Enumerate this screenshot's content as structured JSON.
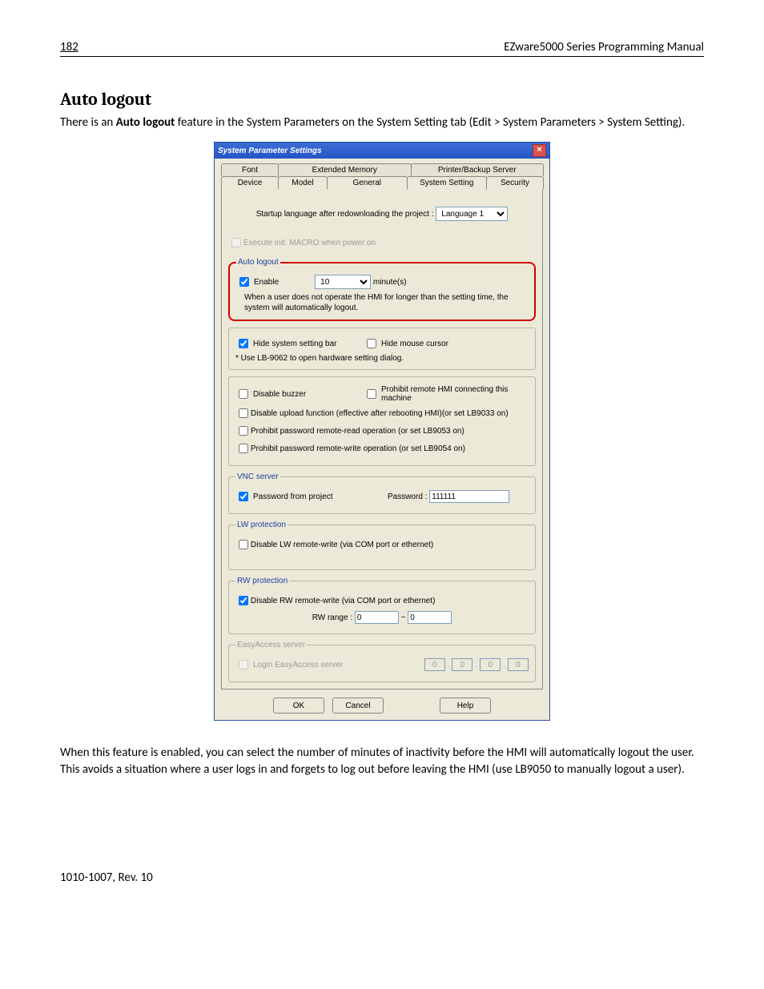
{
  "header": {
    "page_number": "182",
    "manual_title": "EZware5000 Series Programming Manual"
  },
  "section": {
    "heading": "Auto logout",
    "intro_prefix": "There is an ",
    "intro_bold": "Auto logout",
    "intro_suffix": " feature in the System Parameters on the System Setting tab (Edit > System Parameters > System Setting).",
    "after_text": "When this feature is enabled, you can select the number of minutes of inactivity before the HMI will automatically logout the user. This avoids a situation where a user logs in and forgets to log out before leaving the HMI (use LB9050 to manually logout a user)."
  },
  "footer": {
    "rev": "1010-1007, Rev. 10"
  },
  "dialog": {
    "title": "System Parameter Settings",
    "tabs_row1": [
      "Font",
      "Extended Memory",
      "Printer/Backup Server"
    ],
    "tabs_row2": [
      "Device",
      "Model",
      "General",
      "System Setting",
      "Security"
    ],
    "active_tab": "System Setting",
    "startup_lang_label": "Startup language after redownloading the project :",
    "startup_lang_value": "Language 1",
    "exec_macro_label": "Execute init. MACRO when power on",
    "auto_logout": {
      "legend": "Auto logout",
      "enable_label": "Enable",
      "enable_checked": true,
      "minutes_value": "10",
      "unit": "minute(s)",
      "note": "When a user does not operate the HMI for longer than the setting time, the system will automatically logout."
    },
    "misc": {
      "hide_bar_label": "Hide system setting bar",
      "hide_bar_checked": true,
      "hide_cursor_label": "Hide mouse cursor",
      "hide_cursor_checked": false,
      "lb9062_note": "* Use LB-9062 to open hardware setting dialog.",
      "disable_buzzer_label": "Disable buzzer",
      "disable_buzzer_checked": false,
      "prohibit_remote_hmi_label": "Prohibit remote HMI connecting this machine",
      "prohibit_remote_hmi_checked": false,
      "disable_upload_label": "Disable upload function (effective after rebooting HMI)(or set LB9033 on)",
      "disable_upload_checked": false,
      "prohibit_pw_read_label": "Prohibit password remote-read operation (or set LB9053 on)",
      "prohibit_pw_read_checked": false,
      "prohibit_pw_write_label": "Prohibit password remote-write operation (or set LB9054 on)",
      "prohibit_pw_write_checked": false
    },
    "vnc": {
      "legend": "VNC server",
      "pw_from_project_label": "Password from project",
      "pw_from_project_checked": true,
      "password_label": "Password :",
      "password_value": "111111"
    },
    "lw": {
      "legend": "LW protection",
      "disable_label": "Disable LW remote-write (via COM port or ethernet)",
      "disable_checked": false
    },
    "rw": {
      "legend": "RW protection",
      "disable_label": "Disable RW remote-write (via COM port or ethernet)",
      "disable_checked": true,
      "range_label": "RW range :",
      "range_from": "0",
      "range_sep": "~",
      "range_to": "0"
    },
    "easy": {
      "legend": "EasyAccess server",
      "login_label": "Login EasyAccess server",
      "login_checked": false,
      "ip": [
        "0",
        "0",
        "0",
        "0"
      ]
    },
    "buttons": {
      "ok": "OK",
      "cancel": "Cancel",
      "help": "Help"
    }
  }
}
